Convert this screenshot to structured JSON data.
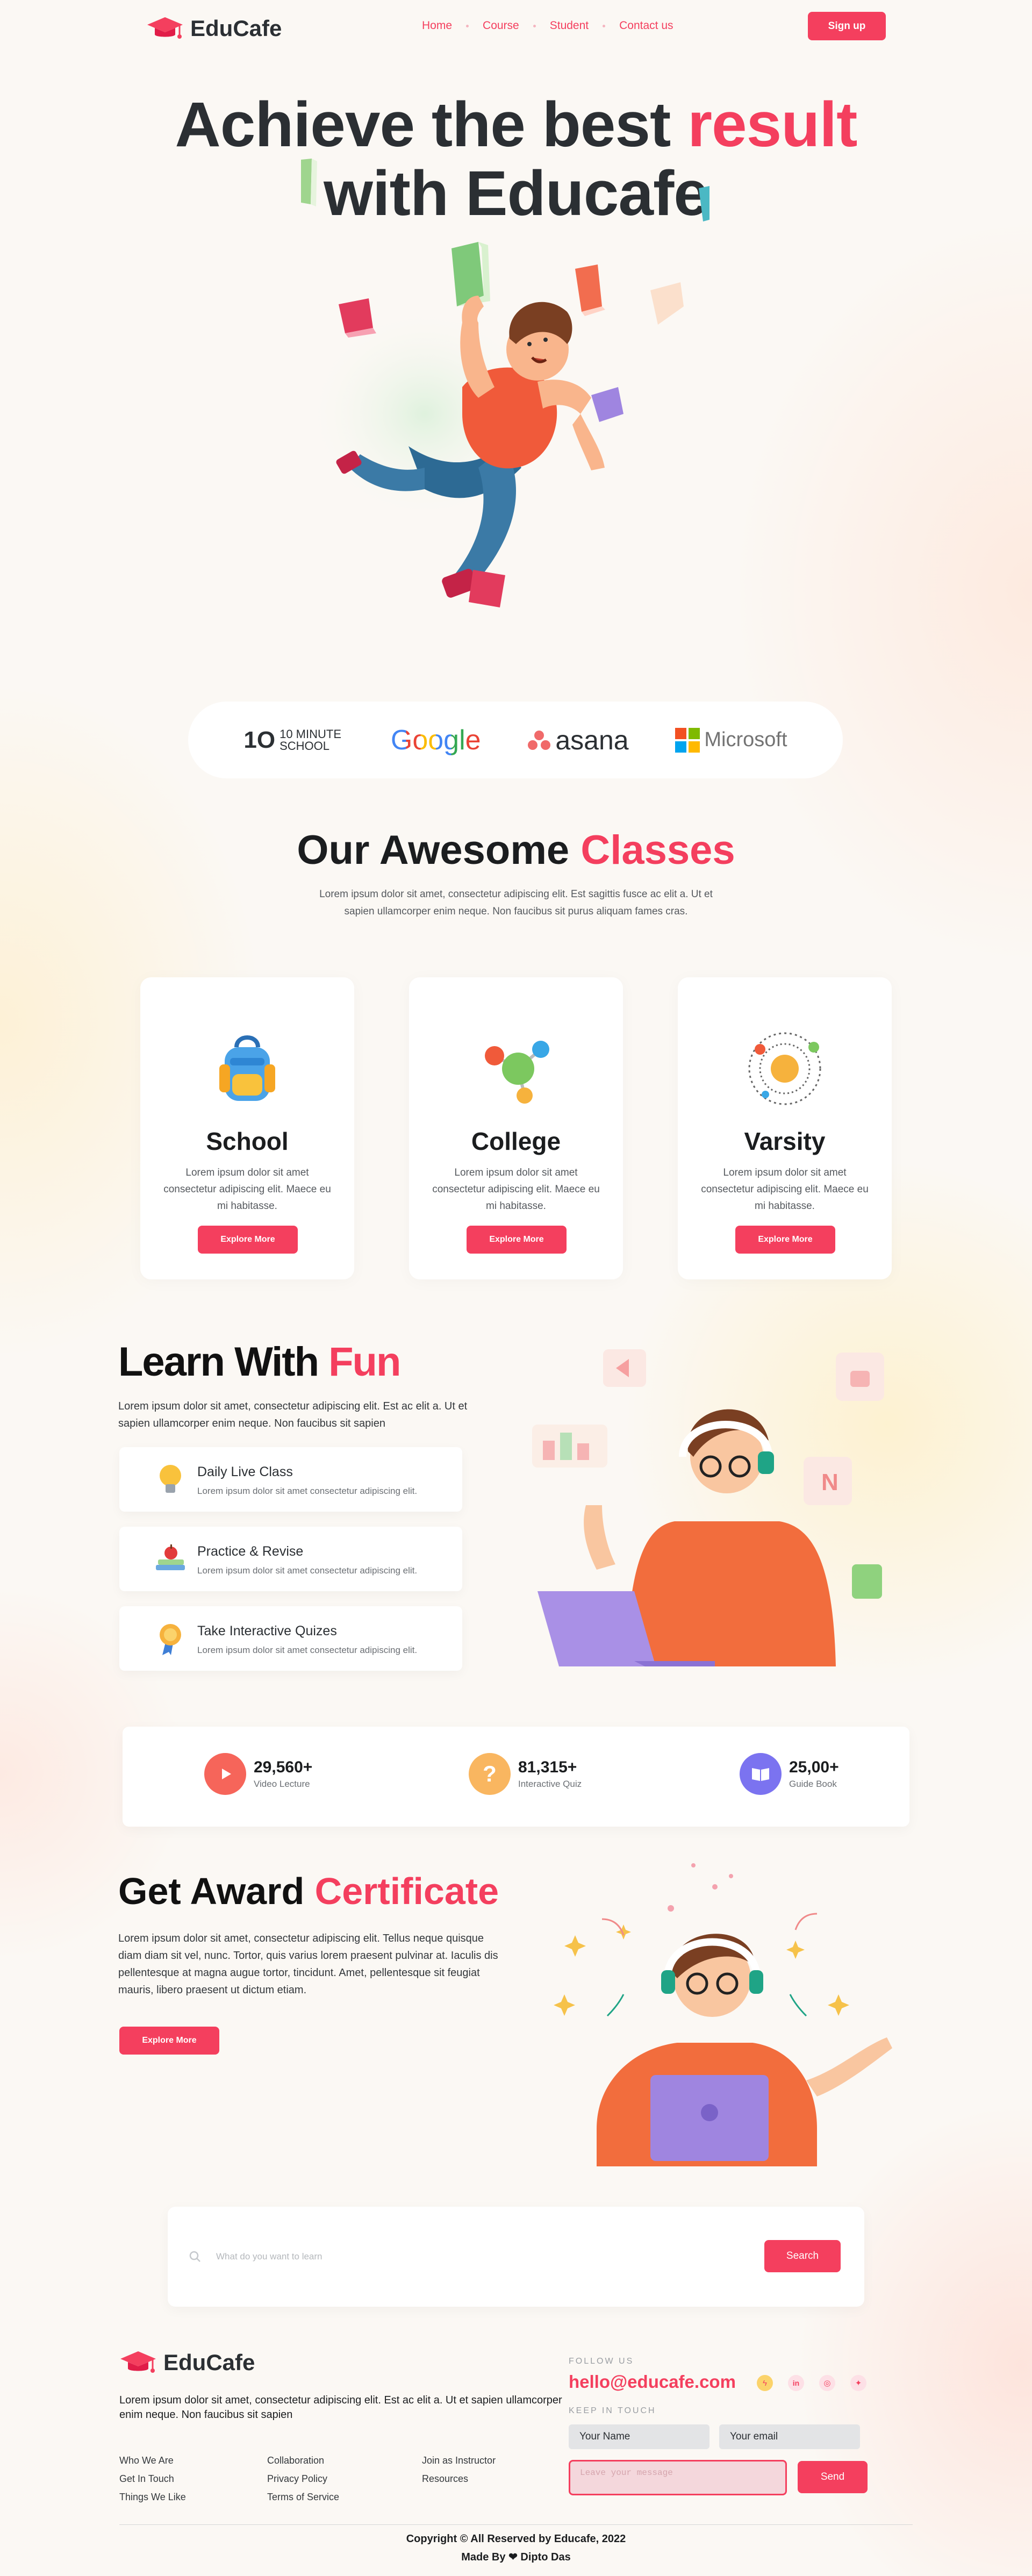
{
  "brand": {
    "name": "EduCafe",
    "accent": "#f43f5e"
  },
  "nav": {
    "links": [
      "Home",
      "Course",
      "Student",
      "Contact us"
    ],
    "signup_label": "Sign up"
  },
  "hero": {
    "title_part1": "Achieve the best ",
    "title_highlight": "result",
    "title_part2": "with Educafe"
  },
  "partners": [
    "10 MINUTE SCHOOL",
    "Google",
    "asana",
    "Microsoft"
  ],
  "classes": {
    "title_part1": "Our Awesome ",
    "title_highlight": "Classes",
    "subtitle": "Lorem ipsum dolor sit amet, consectetur adipiscing elit. Est sagittis fusce ac elit a. Ut et sapien ullamcorper enim neque. Non faucibus sit purus aliquam fames cras.",
    "cards": [
      {
        "icon": "backpack-icon",
        "title": "School",
        "text": "Lorem ipsum dolor sit amet consectetur adipiscing elit. Maece eu mi habitasse.",
        "button": "Explore More"
      },
      {
        "icon": "molecule-icon",
        "title": "College",
        "text": "Lorem ipsum dolor sit amet consectetur adipiscing elit. Maece eu mi habitasse.",
        "button": "Explore More"
      },
      {
        "icon": "atom-icon",
        "title": "Varsity",
        "text": "Lorem ipsum dolor sit amet consectetur adipiscing elit. Maece eu mi habitasse.",
        "button": "Explore More"
      }
    ]
  },
  "learn": {
    "title_part1": "Learn With ",
    "title_highlight": "Fun",
    "subtitle": "Lorem ipsum dolor sit amet, consectetur adipiscing elit. Est ac elit a. Ut et sapien ullamcorper enim neque. Non faucibus sit sapien",
    "features": [
      {
        "icon": "lightbulb-icon",
        "title": "Daily Live Class",
        "text": "Lorem ipsum dolor sit amet consectetur adipiscing elit."
      },
      {
        "icon": "books-apple-icon",
        "title": "Practice & Revise",
        "text": "Lorem ipsum dolor sit amet consectetur adipiscing elit."
      },
      {
        "icon": "medal-icon",
        "title": "Take Interactive Quizes",
        "text": "Lorem ipsum dolor sit amet consectetur adipiscing elit."
      }
    ]
  },
  "stats": [
    {
      "icon": "play-icon",
      "value": "29,560+",
      "label": "Video Lecture",
      "color": "#f6655a"
    },
    {
      "icon": "question-icon",
      "value": "81,315+",
      "label": "Interactive Quiz",
      "color": "#f9b660"
    },
    {
      "icon": "book-icon",
      "value": "25,00+",
      "label": "Guide Book",
      "color": "#7b73f0"
    }
  ],
  "award": {
    "title_part1": "Get Award ",
    "title_highlight": "Certificate",
    "text": "Lorem ipsum dolor sit amet, consectetur adipiscing elit. Tellus neque quisque diam diam sit vel, nunc. Tortor, quis varius lorem praesent pulvinar at. Iaculis dis pellentesque at magna augue tortor, tincidunt. Amet, pellentesque sit feugiat mauris, libero praesent ut dictum etiam.",
    "button": "Explore More"
  },
  "search": {
    "placeholder": "What do you want to learn",
    "button": "Search"
  },
  "footer": {
    "brand": "EduCafe",
    "about": "Lorem ipsum dolor sit amet, consectetur adipiscing elit. Est ac elit a. Ut et sapien ullamcorper enim neque. Non faucibus sit sapien",
    "col1": [
      "Who We Are",
      "Get In Touch",
      "Things We Like"
    ],
    "col2": [
      "Collaboration",
      "Privacy Policy",
      "Terms of Service"
    ],
    "col3": [
      "Join as Instructor",
      "Resources"
    ],
    "follow_label": "FOLLOW US",
    "email": "hello@educafe.com",
    "socials": [
      "flash-icon",
      "linkedin-icon",
      "dribbble-icon",
      "twitter-icon"
    ],
    "keep_label": "KEEP IN TOUCH",
    "name_placeholder": "Your Name",
    "email_placeholder": "Your email",
    "message_placeholder": "Leave your message",
    "send": "Send",
    "copyright": "Copyright © All Reserved by Educafe, 2022",
    "made_by_prefix": "Made By",
    "made_by_name": "Dipto Das"
  }
}
